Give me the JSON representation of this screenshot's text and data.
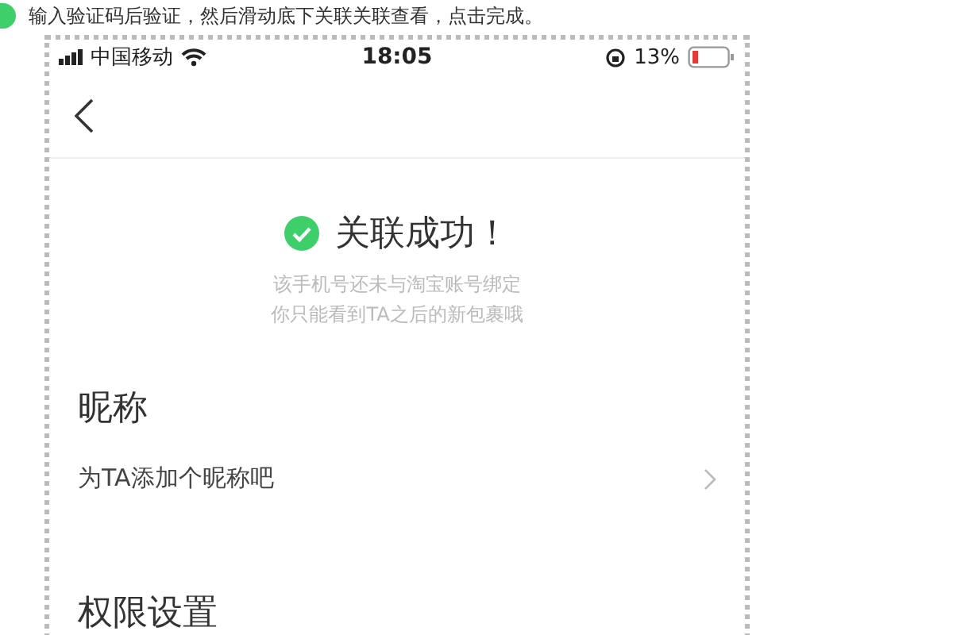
{
  "article": {
    "instruction": "输入验证码后验证，然后滑动底下关联关联查看，点击完成。"
  },
  "status_bar": {
    "carrier": "中国移动",
    "time": "18:05",
    "battery": "13%"
  },
  "result": {
    "title": "关联成功！",
    "lines": [
      "该手机号还未与淘宝账号绑定",
      "你只能看到TA之后的新包裹哦"
    ]
  },
  "sections": [
    {
      "heading": "昵称",
      "row": {
        "label": "为TA添加个昵称吧"
      }
    },
    {
      "heading": "权限设置"
    }
  ]
}
